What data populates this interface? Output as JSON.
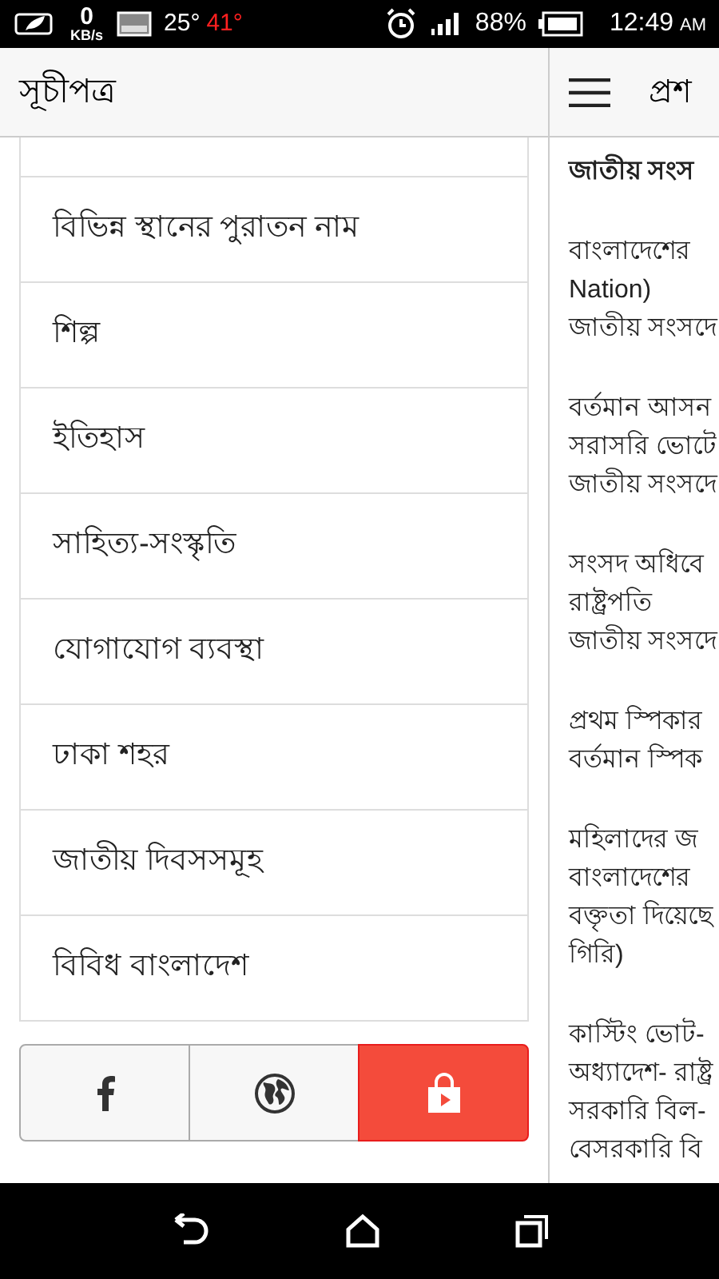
{
  "status_bar": {
    "net_speed": "0",
    "net_unit": "KB/s",
    "temp": "25°",
    "temp_alert": "41°",
    "battery": "88%",
    "time": "12:49",
    "ampm": "AM"
  },
  "sidebar": {
    "title": "সূচীপত্র",
    "items": [
      {
        "label": "বিভিন্ন স্থানের পুরাতন নাম"
      },
      {
        "label": "শিল্প"
      },
      {
        "label": "ইতিহাস"
      },
      {
        "label": "সাহিত্য-সংস্কৃতি"
      },
      {
        "label": "যোগাযোগ ব্যবস্থা"
      },
      {
        "label": "ঢাকা শহর"
      },
      {
        "label": "জাতীয় দিবসসমূহ"
      },
      {
        "label": "বিবিধ বাংলাদেশ"
      }
    ],
    "share_buttons": [
      {
        "kind": "facebook",
        "selected": false
      },
      {
        "kind": "web",
        "selected": false
      },
      {
        "kind": "store",
        "selected": true
      }
    ]
  },
  "content": {
    "title": "প্রশ",
    "heading": "জাতীয় সংস",
    "paragraphs": [
      [
        "বাংলাদেশের",
        "Nation)",
        "জাতীয় সংসদে"
      ],
      [
        "বর্তমান আসন",
        "সরাসরি ভোটে",
        "জাতীয় সংসদে"
      ],
      [
        "সংসদ অধিবে",
        "রাষ্ট্রপতি",
        "জাতীয় সংসদে"
      ],
      [
        "প্রথম স্পিকার",
        "বর্তমান স্পিক"
      ],
      [
        "মহিলাদের জ",
        "বাংলাদেশের",
        "বক্তৃতা দিয়েছে",
        "গিরি)"
      ],
      [
        "কাস্টিং ভোট-",
        "অধ্যাদেশ- রাষ্ট্র",
        "সরকারি বিল-",
        "বেসরকারি বি"
      ]
    ]
  }
}
